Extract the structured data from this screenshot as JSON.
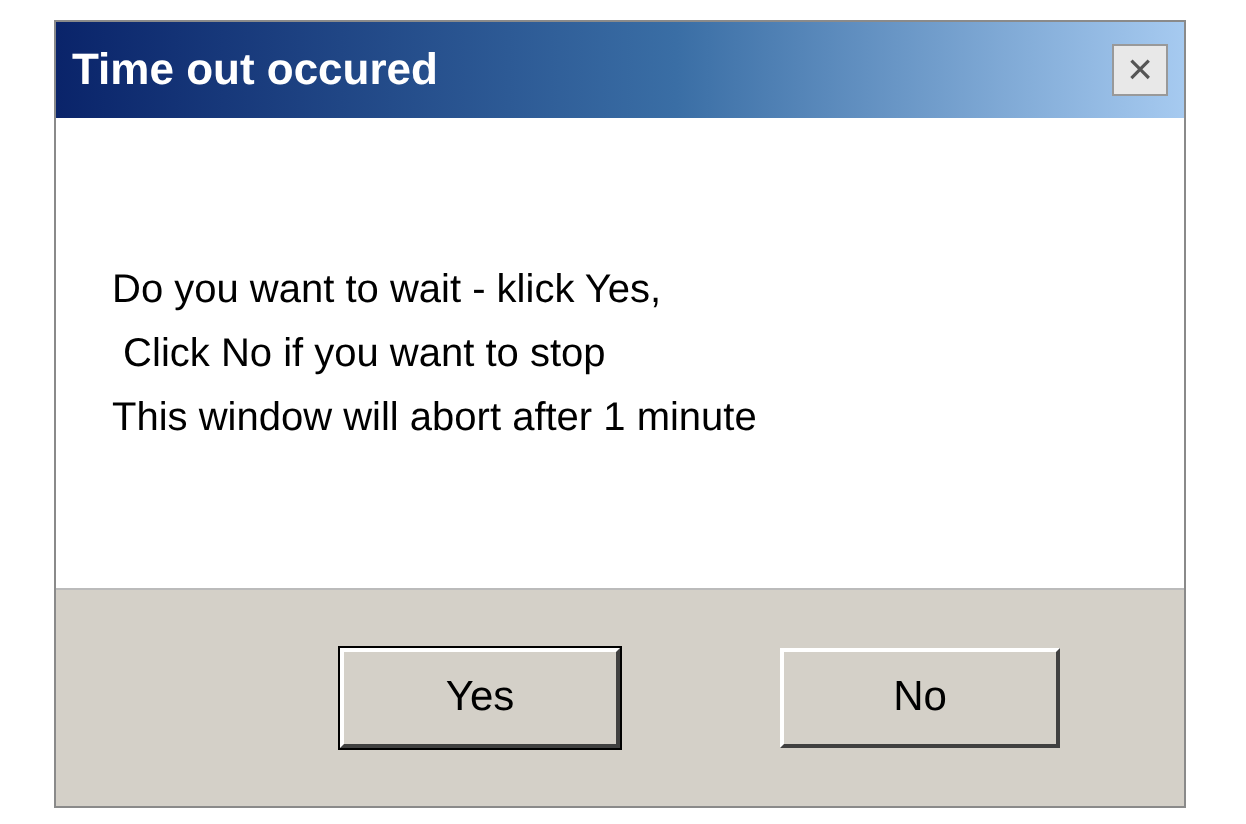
{
  "window": {
    "title": "Time out occured",
    "close": "×"
  },
  "message": "Do you want to wait - klick Yes,\n Click No if you want to stop\nThis window will abort after 1 minute",
  "buttons": [
    {
      "label": "Yes",
      "selected": true
    },
    {
      "label": "No",
      "selected": false
    }
  ]
}
